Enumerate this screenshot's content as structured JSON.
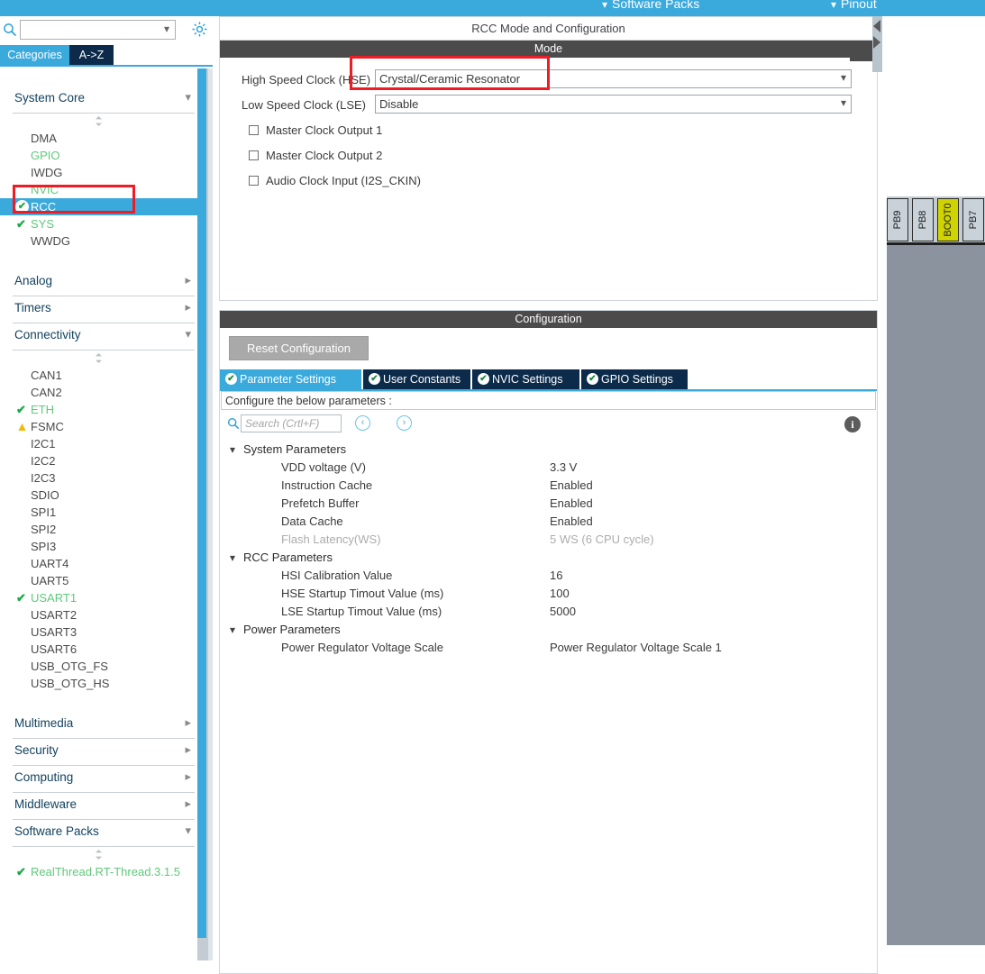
{
  "topbar": {
    "menus": [
      {
        "label": "Software Packs",
        "icon": "chevron-down-icon"
      },
      {
        "label": "Pinout",
        "icon": "chevron-down-icon"
      }
    ]
  },
  "sidebar": {
    "search": {
      "value": "",
      "placeholder": ""
    },
    "gear_icon": "gear-icon",
    "search_icon": "search-icon",
    "tabs": [
      {
        "label": "Categories",
        "active": true
      },
      {
        "label": "A->Z",
        "active": false
      }
    ],
    "groups": [
      {
        "label": "System Core",
        "expanded": true,
        "items": [
          {
            "label": "DMA",
            "state": "none"
          },
          {
            "label": "GPIO",
            "state": "green"
          },
          {
            "label": "IWDG",
            "state": "none"
          },
          {
            "label": "NVIC",
            "state": "green"
          },
          {
            "label": "RCC",
            "state": "checked-selected"
          },
          {
            "label": "SYS",
            "state": "check-green"
          },
          {
            "label": "WWDG",
            "state": "none"
          }
        ]
      },
      {
        "label": "Analog",
        "expanded": false,
        "items": []
      },
      {
        "label": "Timers",
        "expanded": false,
        "items": []
      },
      {
        "label": "Connectivity",
        "expanded": true,
        "items": [
          {
            "label": "CAN1",
            "state": "none"
          },
          {
            "label": "CAN2",
            "state": "none"
          },
          {
            "label": "ETH",
            "state": "check-green"
          },
          {
            "label": "FSMC",
            "state": "warning"
          },
          {
            "label": "I2C1",
            "state": "none"
          },
          {
            "label": "I2C2",
            "state": "none"
          },
          {
            "label": "I2C3",
            "state": "none"
          },
          {
            "label": "SDIO",
            "state": "none"
          },
          {
            "label": "SPI1",
            "state": "none"
          },
          {
            "label": "SPI2",
            "state": "none"
          },
          {
            "label": "SPI3",
            "state": "none"
          },
          {
            "label": "UART4",
            "state": "none"
          },
          {
            "label": "UART5",
            "state": "none"
          },
          {
            "label": "USART1",
            "state": "check-green"
          },
          {
            "label": "USART2",
            "state": "none"
          },
          {
            "label": "USART3",
            "state": "none"
          },
          {
            "label": "USART6",
            "state": "none"
          },
          {
            "label": "USB_OTG_FS",
            "state": "none"
          },
          {
            "label": "USB_OTG_HS",
            "state": "none"
          }
        ]
      },
      {
        "label": "Multimedia",
        "expanded": false,
        "items": []
      },
      {
        "label": "Security",
        "expanded": false,
        "items": []
      },
      {
        "label": "Computing",
        "expanded": false,
        "items": []
      },
      {
        "label": "Middleware",
        "expanded": false,
        "items": []
      },
      {
        "label": "Software Packs",
        "expanded": true,
        "items": [
          {
            "label": "RealThread.RT-Thread.3.1.5",
            "state": "check-green"
          }
        ]
      }
    ]
  },
  "main": {
    "title": "RCC Mode and Configuration",
    "mode": {
      "header": "Mode",
      "rows": [
        {
          "label": "High Speed Clock (HSE)",
          "value": "Crystal/Ceramic Resonator"
        },
        {
          "label": "Low Speed Clock (LSE)",
          "value": "Disable"
        }
      ],
      "checkboxes": [
        {
          "label": "Master Clock Output 1",
          "checked": false
        },
        {
          "label": "Master Clock Output 2",
          "checked": false
        },
        {
          "label": "Audio Clock Input (I2S_CKIN)",
          "checked": false
        }
      ]
    },
    "configuration": {
      "header": "Configuration",
      "reset_label": "Reset Configuration",
      "tabs": [
        {
          "label": "Parameter Settings",
          "active": true
        },
        {
          "label": "User Constants",
          "active": false
        },
        {
          "label": "NVIC Settings",
          "active": false
        },
        {
          "label": "GPIO Settings",
          "active": false
        }
      ],
      "hint": "Configure the below parameters :",
      "search_placeholder": "Search (Crtl+F)",
      "search_value": "",
      "nav_prev": "‹",
      "nav_next": "›",
      "info_icon": "info-icon",
      "tree": [
        {
          "kind": "group",
          "label": "System Parameters"
        },
        {
          "kind": "param",
          "name": "VDD voltage (V)",
          "value": "3.3 V",
          "dim": false
        },
        {
          "kind": "param",
          "name": "Instruction Cache",
          "value": "Enabled",
          "dim": false
        },
        {
          "kind": "param",
          "name": "Prefetch Buffer",
          "value": "Enabled",
          "dim": false
        },
        {
          "kind": "param",
          "name": "Data Cache",
          "value": "Enabled",
          "dim": false
        },
        {
          "kind": "param",
          "name": "Flash Latency(WS)",
          "value": "5 WS (6 CPU cycle)",
          "dim": true
        },
        {
          "kind": "group",
          "label": "RCC Parameters"
        },
        {
          "kind": "param",
          "name": "HSI Calibration Value",
          "value": "16",
          "dim": false
        },
        {
          "kind": "param",
          "name": "HSE Startup Timout Value (ms)",
          "value": "100",
          "dim": false
        },
        {
          "kind": "param",
          "name": "LSE Startup Timout Value (ms)",
          "value": "5000",
          "dim": false
        },
        {
          "kind": "group",
          "label": "Power Parameters"
        },
        {
          "kind": "param",
          "name": "Power Regulator Voltage Scale",
          "value": "Power Regulator Voltage Scale 1",
          "dim": false
        }
      ]
    }
  },
  "chip": {
    "pins": [
      {
        "label": "PB9",
        "highlight": false
      },
      {
        "label": "PB8",
        "highlight": false
      },
      {
        "label": "BOOT0",
        "highlight": true
      },
      {
        "label": "PB7",
        "highlight": false
      }
    ]
  },
  "colors": {
    "accent": "#3aa9dc",
    "tab_inactive": "#0c2b4b",
    "section_header": "#4b4b4b",
    "green": "#5fc97a",
    "warning": "#f0b90b",
    "annotation": "#ee1c25",
    "boot_pin": "#cfd302",
    "chip_body": "#8b939e"
  }
}
